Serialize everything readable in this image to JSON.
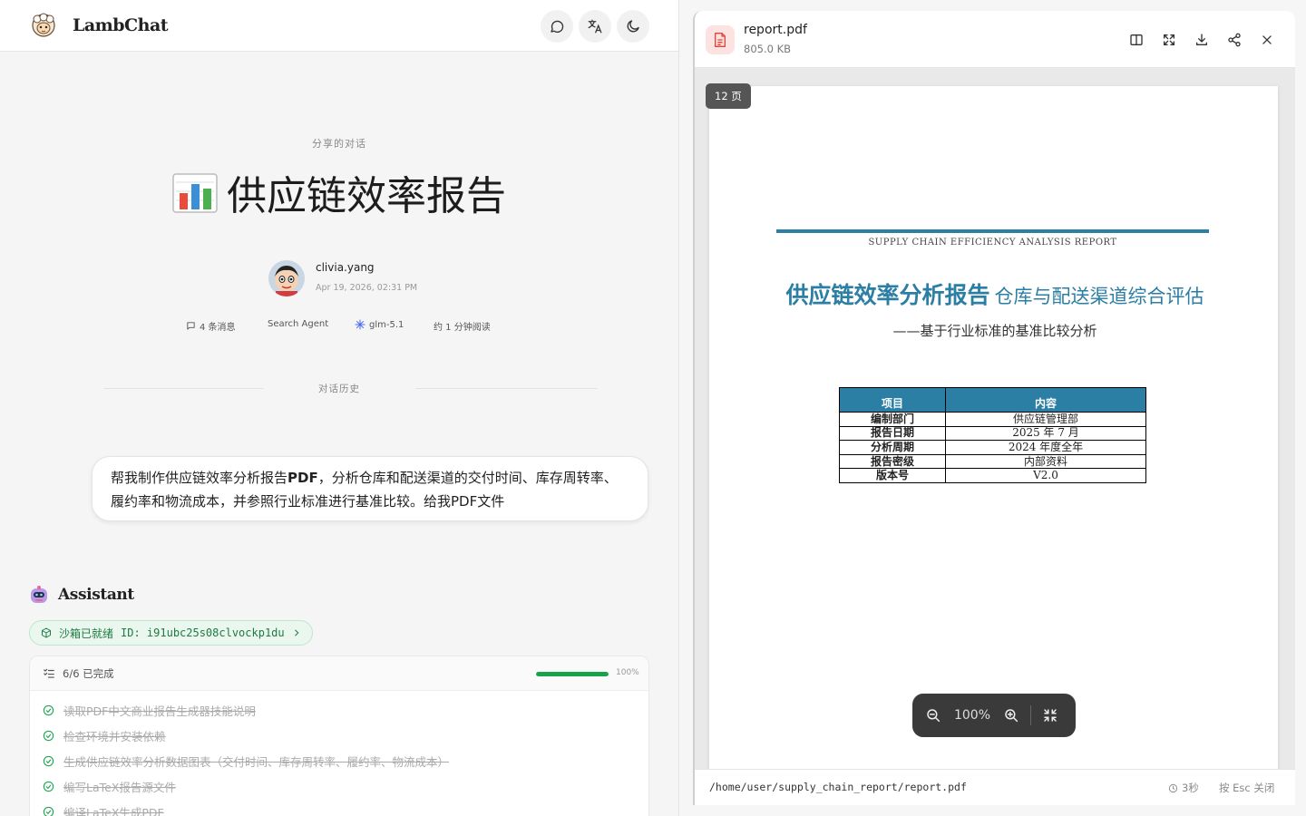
{
  "app": {
    "title": "LambChat"
  },
  "header": {
    "buttons": [
      {
        "name": "chat-icon"
      },
      {
        "name": "translate-icon"
      },
      {
        "name": "moon-icon"
      }
    ]
  },
  "conversation": {
    "share_label": "分享的对话",
    "title_emoji": "bar-chart-emoji",
    "title": "供应链效率报告",
    "author": {
      "name": "clivia.yang",
      "date": "Apr 19, 2026, 02:31 PM"
    },
    "meta": {
      "messages": "4 条消息",
      "agent": "Search Agent",
      "model": "glm-5.1",
      "read_time": "约 1 分钟阅读"
    },
    "history_label": "对话历史",
    "user_message": "帮我制作供应链效率分析报告PDF，分析仓库和配送渠道的交付时间、库存周转率、履约率和物流成本，并参照行业标准进行基准比较。给我PDF文件",
    "user_message_bold": "PDF",
    "assistant": {
      "name": "Assistant",
      "sandbox_status": "沙箱已就绪",
      "sandbox_id": "ID: i91ubc25s08clvockp1du",
      "tasks_summary": "6/6 已完成",
      "progress": 1.0,
      "progress_label": "100%",
      "tasks": [
        "读取PDF中文商业报告生成器技能说明",
        "检查环境并安装依赖",
        "生成供应链效率分析数据图表（交付时间、库存周转率、履约率、物流成本）",
        "编写LaTeX报告源文件",
        "编译LaTeX生成PDF"
      ]
    }
  },
  "viewer": {
    "file_name": "report.pdf",
    "file_size": "805.0 KB",
    "page_badge": "12 页",
    "zoom": "100%",
    "path": "/home/user/supply_chain_report/report.pdf",
    "timer": "3秒",
    "esc_hint": "按 Esc 关闭",
    "pdf": {
      "subtitle_en": "SUPPLY CHAIN EFFICIENCY ANALYSIS REPORT",
      "title_main": "供应链效率分析报告",
      "title_sub": "仓库与配送渠道综合评估",
      "title_tail": "——基于行业标准的基准比较分析",
      "table": {
        "headers": [
          "项目",
          "内容"
        ],
        "rows": [
          [
            "编制部门",
            "供应链管理部"
          ],
          [
            "报告日期",
            "2025 年 7 月"
          ],
          [
            "分析周期",
            "2024 年度全年"
          ],
          [
            "报告密级",
            "内部资料"
          ],
          [
            "版本号",
            "V2.0"
          ]
        ]
      }
    }
  },
  "colors": {
    "accent": "#2b7ea4",
    "success": "#16a34a",
    "pdf_red": "#e0453a"
  }
}
